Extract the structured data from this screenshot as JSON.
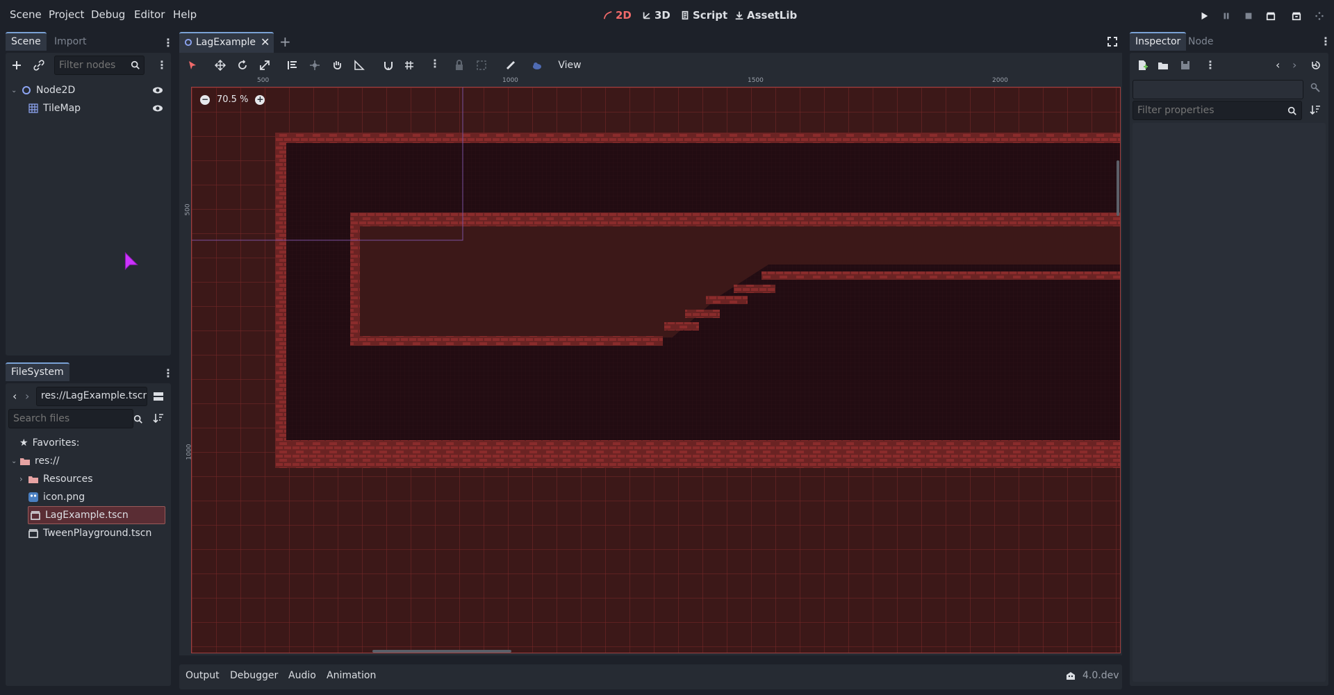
{
  "menu": [
    "Scene",
    "Project",
    "Debug",
    "Editor",
    "Help"
  ],
  "workspaces": [
    {
      "label": "2D",
      "active": true
    },
    {
      "label": "3D",
      "active": false
    },
    {
      "label": "Script",
      "active": false
    },
    {
      "label": "AssetLib",
      "active": false
    }
  ],
  "scene_dock": {
    "tabs": [
      "Scene",
      "Import"
    ],
    "filter_placeholder": "Filter nodes",
    "nodes": [
      {
        "label": "Node2D",
        "icon": "node2d-icon"
      },
      {
        "label": "TileMap",
        "icon": "tilemap-icon"
      }
    ]
  },
  "filesystem_dock": {
    "tab": "FileSystem",
    "path": "res://LagExample.tscn",
    "search_placeholder": "Search files",
    "favorites_label": "Favorites:",
    "root_label": "res://",
    "items": [
      {
        "label": "Resources",
        "icon": "folder-icon"
      },
      {
        "label": "icon.png",
        "icon": "image-icon"
      },
      {
        "label": "LagExample.tscn",
        "icon": "scene-file-icon",
        "selected": true
      },
      {
        "label": "TweenPlayground.tscn",
        "icon": "scene-file-icon"
      }
    ]
  },
  "editor": {
    "scene_tab": "LagExample",
    "view_label": "View",
    "zoom": "70.5 %",
    "ruler_top": [
      "500",
      "1000",
      "1500",
      "2000"
    ],
    "ruler_left": [
      "500",
      "1000"
    ]
  },
  "inspector": {
    "tabs": [
      "Inspector",
      "Node"
    ],
    "filter_placeholder": "Filter properties"
  },
  "bottom": {
    "tabs": [
      "Output",
      "Debugger",
      "Audio",
      "Animation"
    ],
    "version": "4.0.dev"
  },
  "colors": {
    "accent_2d": "#f06a6a",
    "tile_brick": "#8a2c2c",
    "dark_fill": "#1c0b10",
    "canvas_bg": "#3c1818"
  }
}
